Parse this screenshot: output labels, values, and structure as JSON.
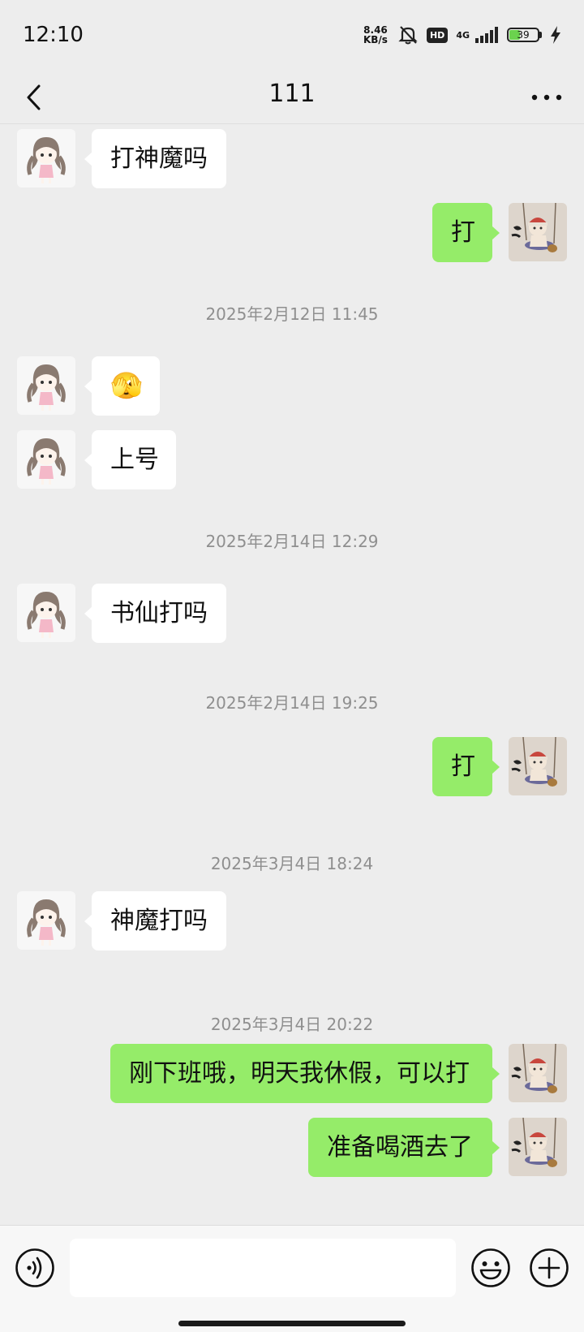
{
  "status_bar": {
    "time": "12:10",
    "net_speed_value": "8.46",
    "net_speed_unit": "KB/s",
    "hd_badge": "HD",
    "network": "4G",
    "battery_level": "39",
    "battery_fraction": 0.39,
    "icons": [
      "mute-bell-icon",
      "hd-icon",
      "signal-icon",
      "battery-icon",
      "charging-bolt-icon"
    ]
  },
  "nav": {
    "title": "111",
    "back_icon": "chevron-left-icon",
    "more_icon": "more-dots-icon"
  },
  "messages": [
    {
      "type": "message",
      "side": "left",
      "text": "打神魔吗"
    },
    {
      "type": "message",
      "side": "right",
      "text": "打"
    },
    {
      "type": "timestamp",
      "text": "2025年2月12日 11:45"
    },
    {
      "type": "message",
      "side": "left",
      "text": "🫣",
      "emoji": true
    },
    {
      "type": "message",
      "side": "left",
      "text": "上号"
    },
    {
      "type": "timestamp",
      "text": "2025年2月14日 12:29"
    },
    {
      "type": "message",
      "side": "left",
      "text": "书仙打吗"
    },
    {
      "type": "timestamp",
      "text": "2025年2月14日 19:25"
    },
    {
      "type": "message",
      "side": "right",
      "text": "打"
    },
    {
      "type": "timestamp",
      "text": "2025年3月4日 18:24"
    },
    {
      "type": "message",
      "side": "left",
      "text": "神魔打吗"
    },
    {
      "type": "timestamp",
      "text": "2025年3月4日 20:22"
    },
    {
      "type": "message",
      "side": "right",
      "text": "刚下班哦，明天我休假，可以打"
    },
    {
      "type": "message",
      "side": "right",
      "text": "准备喝酒去了"
    }
  ],
  "input_bar": {
    "voice_icon": "voice-mode-icon",
    "mic_icon": "microphone-icon",
    "emoji_icon": "emoji-icon",
    "plus_icon": "plus-icon",
    "text_value": ""
  },
  "colors": {
    "background": "#ededed",
    "bubble_self": "#95ec69",
    "bubble_other": "#ffffff",
    "timestamp_text": "#8f8f8f"
  }
}
